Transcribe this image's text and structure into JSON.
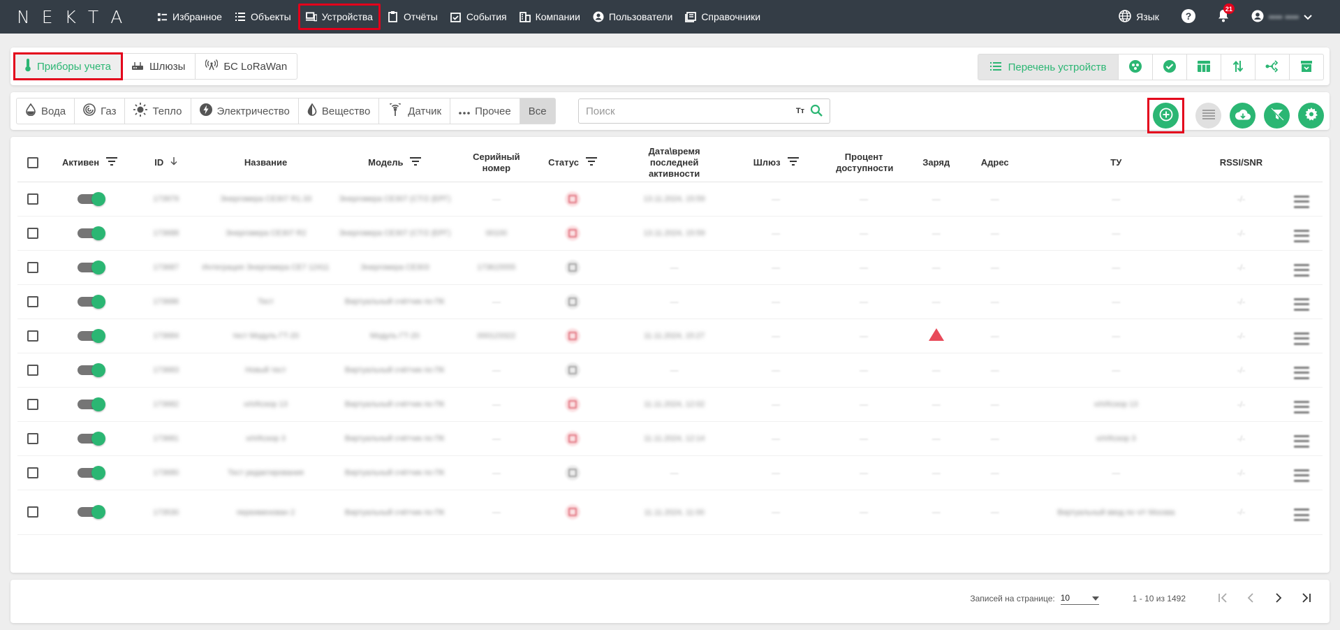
{
  "app": {
    "logo": [
      "N",
      "E",
      "K",
      "T",
      "A"
    ]
  },
  "nav": [
    {
      "label": "Избранное",
      "icon": "star-list-icon"
    },
    {
      "label": "Объекты",
      "icon": "list-icon"
    },
    {
      "label": "Устройства",
      "icon": "devices-icon",
      "active": true
    },
    {
      "label": "Отчёты",
      "icon": "clipboard-icon"
    },
    {
      "label": "События",
      "icon": "calendar-check-icon"
    },
    {
      "label": "Компании",
      "icon": "building-icon"
    },
    {
      "label": "Пользователи",
      "icon": "user-circle-icon"
    },
    {
      "label": "Справочники",
      "icon": "book-icon"
    }
  ],
  "topright": {
    "language": "Язык",
    "notifications_count": "21",
    "username": "•••• ••••"
  },
  "device_tabs": [
    {
      "label": "Приборы учета",
      "icon": "thermometer-icon",
      "active": true
    },
    {
      "label": "Шлюзы",
      "icon": "router-icon"
    },
    {
      "label": "БС LoRaWan",
      "icon": "antenna-icon"
    }
  ],
  "view_modes": {
    "list_label": "Перечень устройств",
    "others": [
      "cluster-icon",
      "check-circle-icon",
      "table-icon",
      "sort-arrows-icon",
      "branch-icon",
      "archive-icon"
    ]
  },
  "resource_filters": [
    {
      "label": "Вода",
      "icon": "drop-icon"
    },
    {
      "label": "Газ",
      "icon": "gas-spiral-icon"
    },
    {
      "label": "Тепло",
      "icon": "sun-icon"
    },
    {
      "label": "Электричество",
      "icon": "bolt-icon"
    },
    {
      "label": "Вещество",
      "icon": "substance-drop-icon"
    },
    {
      "label": "Датчик",
      "icon": "sensor-icon"
    },
    {
      "label": "Прочее",
      "icon": "more-dots-icon"
    },
    {
      "label": "Все",
      "icon": "",
      "active": true
    }
  ],
  "search": {
    "placeholder": "Поиск",
    "tt": "Тт"
  },
  "table": {
    "headers": {
      "active": "Активен",
      "id": "ID",
      "name": "Название",
      "model": "Модель",
      "serial": "Серийный номер",
      "status": "Статус",
      "last_activity": "Дата\\время последней активности",
      "gateway": "Шлюз",
      "availability": "Процент доступности",
      "charge": "Заряд",
      "address": "Адрес",
      "tu": "ТУ",
      "rssi": "RSSI/SNR"
    },
    "rows": [
      {
        "id": "173979",
        "name": "Энергомера CE307 R1.33",
        "model": "Энергомера CE307 (CT/2 (ЕРГ)",
        "serial": "—",
        "status": "red",
        "activity": "13.11.2024, 15:59",
        "gateway": "—",
        "avail": "—",
        "charge": "—",
        "address": "—",
        "tu": "—",
        "rssi": "-/-"
      },
      {
        "id": "173688",
        "name": "Энергомера CE307 R2",
        "model": "Энергомера CE307 (CT/2 (ЕРГ)",
        "serial": "00100",
        "status": "red",
        "activity": "13.11.2024, 15:59",
        "gateway": "—",
        "avail": "—",
        "charge": "—",
        "address": "—",
        "tu": "—",
        "rssi": "-/-"
      },
      {
        "id": "173687",
        "name": "Интеграция Энергомера CE7 12411",
        "model": "Энергомера CE303",
        "serial": "173615555",
        "status": "grey",
        "activity": "—",
        "gateway": "—",
        "avail": "—",
        "charge": "—",
        "address": "—",
        "tu": "—",
        "rssi": "-/-"
      },
      {
        "id": "173686",
        "name": "Тест",
        "model": "Виртуальный счётчик по ПК",
        "serial": "—",
        "status": "grey",
        "activity": "—",
        "gateway": "—",
        "avail": "—",
        "charge": "—",
        "address": "—",
        "tu": "—",
        "rssi": "-/-"
      },
      {
        "id": "173684",
        "name": "тест Модуль ГТ-20",
        "model": "Модуль ГТ-20",
        "serial": "000123322",
        "status": "red",
        "activity": "11.11.2024, 15:27",
        "gateway": "—",
        "avail": "—",
        "charge": "warn",
        "address": "—",
        "tu": "—",
        "rssi": "-/-"
      },
      {
        "id": "173683",
        "name": "Новый тест",
        "model": "Виртуальный счётчик по ПК",
        "serial": "—",
        "status": "grey",
        "activity": "—",
        "gateway": "—",
        "avail": "—",
        "charge": "—",
        "address": "—",
        "tu": "—",
        "rssi": "-/-"
      },
      {
        "id": "173682",
        "name": "н/п/Кскор 13",
        "model": "Виртуальный счётчик по ПК",
        "serial": "—",
        "status": "red",
        "activity": "11.11.2024, 12:02",
        "gateway": "—",
        "avail": "—",
        "charge": "—",
        "address": "—",
        "tu": "н/п/Кскор 13",
        "rssi": "-/-"
      },
      {
        "id": "173681",
        "name": "н/п/Кскор 3",
        "model": "Виртуальный счётчик по ПК",
        "serial": "—",
        "status": "red",
        "activity": "11.11.2024, 12:14",
        "gateway": "—",
        "avail": "—",
        "charge": "—",
        "address": "—",
        "tu": "н/п/Кскор 3",
        "rssi": "-/-"
      },
      {
        "id": "173680",
        "name": "Тест редактирования",
        "model": "Виртуальный счётчик по ПК",
        "serial": "—",
        "status": "grey",
        "activity": "—",
        "gateway": "—",
        "avail": "—",
        "charge": "—",
        "address": "—",
        "tu": "—",
        "rssi": "-/-"
      },
      {
        "id": "173530",
        "name": "переименован 2",
        "model": "Виртуальный счётчик по ПК",
        "serial": "—",
        "status": "red",
        "activity": "11.11.2024, 11:00",
        "gateway": "—",
        "avail": "—",
        "charge": "—",
        "address": "—",
        "tu": "Виртуальный ввод по ч/т Москва",
        "rssi": "-/-",
        "tall": true
      }
    ]
  },
  "pager": {
    "per_page_label": "Записей на странице:",
    "per_page": "10",
    "range": "1 - 10 из 1492"
  },
  "colors": {
    "accent": "#2bb673",
    "topbar": "#343d46",
    "highlight": "#e3001b"
  }
}
